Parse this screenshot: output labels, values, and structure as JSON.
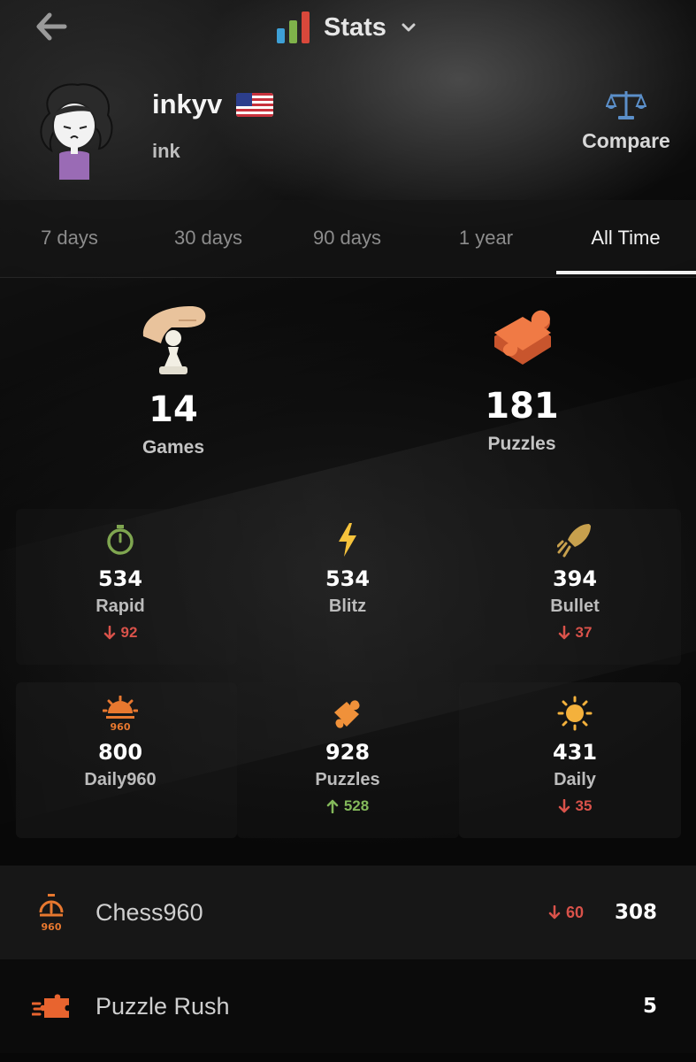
{
  "header": {
    "title": "Stats",
    "back_icon": "arrow-left-icon",
    "title_icon": "bar-chart-icon",
    "menu_icon": "chevron-down-icon"
  },
  "profile": {
    "username": "inkyv",
    "display_name": "ink",
    "country_flag": "us-flag-icon",
    "compare_label": "Compare"
  },
  "tabs": [
    {
      "label": "7 days",
      "active": false
    },
    {
      "label": "30 days",
      "active": false
    },
    {
      "label": "90 days",
      "active": false
    },
    {
      "label": "1 year",
      "active": false
    },
    {
      "label": "All Time",
      "active": true
    }
  ],
  "summary": [
    {
      "value": "14",
      "label": "Games",
      "icon": "hand-pawn-icon"
    },
    {
      "value": "181",
      "label": "Puzzles",
      "icon": "puzzle-piece-icon"
    }
  ],
  "ratings": [
    {
      "value": "534",
      "label": "Rapid",
      "delta": "92",
      "direction": "down",
      "icon": "stopwatch-icon",
      "color": "#7fa650"
    },
    {
      "value": "534",
      "label": "Blitz",
      "delta": "",
      "direction": "",
      "icon": "lightning-icon",
      "color": "#f6c33c"
    },
    {
      "value": "394",
      "label": "Bullet",
      "delta": "37",
      "direction": "down",
      "icon": "bullet-icon",
      "color": "#c7a04d"
    },
    {
      "value": "800",
      "label": "Daily960",
      "delta": "",
      "direction": "",
      "icon": "sun-960-icon",
      "color": "#e8782f"
    },
    {
      "value": "928",
      "label": "Puzzles",
      "delta": "528",
      "direction": "up",
      "icon": "puzzle-icon",
      "color": "#f0913a"
    },
    {
      "value": "431",
      "label": "Daily",
      "delta": "35",
      "direction": "down",
      "icon": "sun-icon",
      "color": "#f4b13c"
    }
  ],
  "rows": [
    {
      "label": "Chess960",
      "delta": "60",
      "direction": "down",
      "value": "308",
      "icon": "stopwatch-960-icon"
    },
    {
      "label": "Puzzle Rush",
      "delta": "",
      "direction": "",
      "value": "5",
      "icon": "puzzle-rush-icon"
    }
  ],
  "colors": {
    "down": "#d9524a",
    "up": "#83b85a",
    "accent_orange": "#e8782f"
  }
}
